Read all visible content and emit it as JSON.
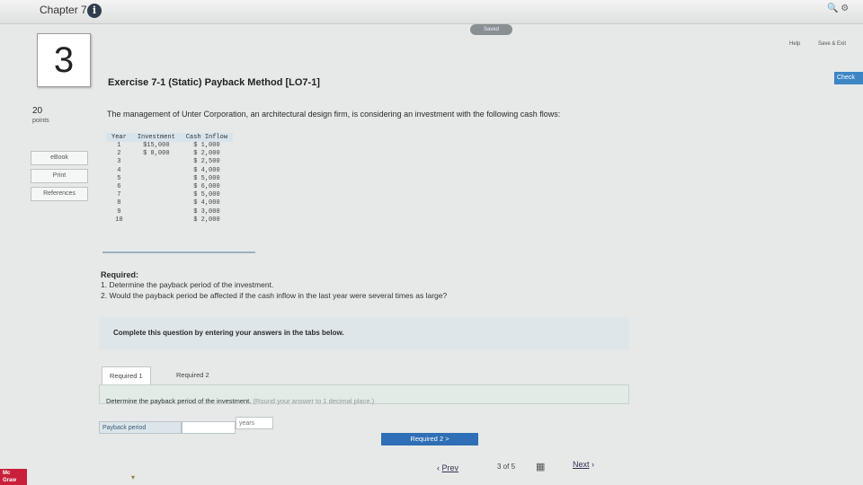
{
  "header": {
    "chapter": "Chapter 7",
    "saved": "Saved",
    "help": "Help",
    "save_exit": "Save & Exit",
    "check": "Check"
  },
  "question": {
    "number": "3",
    "points_value": "20",
    "points_label": "points",
    "title": "Exercise 7-1 (Static) Payback Method [LO7-1]",
    "intro": "The management of Unter Corporation, an architectural design firm, is considering an investment with the following cash flows:"
  },
  "sidebar": {
    "ebook": "eBook",
    "print": "Print",
    "references": "References"
  },
  "cash_table": {
    "headers": [
      "Year",
      "Investment",
      "Cash Inflow"
    ],
    "rows": [
      {
        "year": "1",
        "investment": "$15,000",
        "inflow": "$ 1,000"
      },
      {
        "year": "2",
        "investment": "$ 8,000",
        "inflow": "$ 2,000"
      },
      {
        "year": "3",
        "investment": "",
        "inflow": "$ 2,500"
      },
      {
        "year": "4",
        "investment": "",
        "inflow": "$ 4,000"
      },
      {
        "year": "5",
        "investment": "",
        "inflow": "$ 5,000"
      },
      {
        "year": "6",
        "investment": "",
        "inflow": "$ 6,000"
      },
      {
        "year": "7",
        "investment": "",
        "inflow": "$ 5,000"
      },
      {
        "year": "8",
        "investment": "",
        "inflow": "$ 4,000"
      },
      {
        "year": "9",
        "investment": "",
        "inflow": "$ 3,000"
      },
      {
        "year": "10",
        "investment": "",
        "inflow": "$ 2,000"
      }
    ]
  },
  "required": {
    "heading": "Required:",
    "item1": "1. Determine the payback period of the investment.",
    "item2": "2. Would the payback period be affected if the cash inflow in the last year were several times as large?"
  },
  "instructions": "Complete this question by entering your answers in the tabs below.",
  "tabs": {
    "tab1": "Required 1",
    "tab2": "Required 2"
  },
  "panel": {
    "determine": "Determine the payback period of the investment.",
    "hint": "(Round your answer to 1 decimal place.)",
    "payback_label": "Payback period",
    "payback_value": "",
    "unit": "years",
    "next_req_button": "Required 2  >"
  },
  "footer": {
    "prev": "Prev",
    "pager": "3 of 5",
    "next": "Next",
    "logo_line1": "Mc",
    "logo_line2": "Graw"
  }
}
